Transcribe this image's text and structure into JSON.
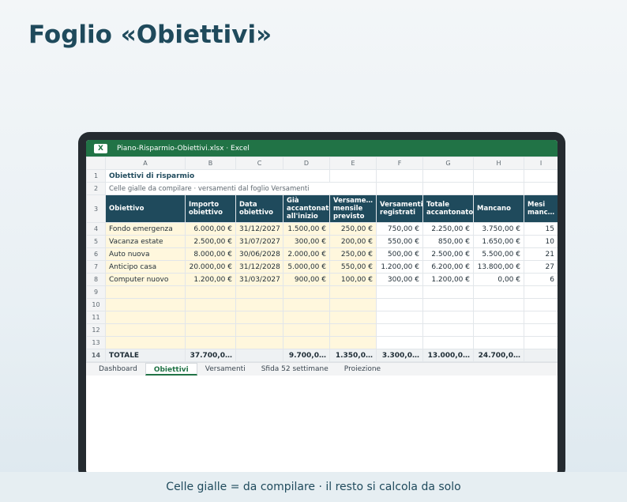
{
  "page": {
    "title": "Foglio «Obiettivi»",
    "footer": "Celle gialle = da compilare · il resto si calcola da solo"
  },
  "window": {
    "app_icon": "X",
    "title": "Piano-Risparmio-Obiettivi.xlsx · Excel"
  },
  "columns": [
    "A",
    "B",
    "C",
    "D",
    "E",
    "F",
    "G",
    "H",
    "I"
  ],
  "sheet": {
    "title": "Obiettivi di risparmio",
    "subtitle": "Celle gialle da compilare · versamenti dal foglio Versamenti",
    "headers": [
      "Obiettivo",
      "Importo obiettivo",
      "Data obiettivo",
      "Già accantonato all'inizio",
      "Versamento mensile previsto",
      "Versamenti registrati",
      "Totale accantonato",
      "Mancano",
      "Mesi mancanti"
    ],
    "headers_display": [
      "Obiettivo",
      "Importo obiettivo",
      "Data obiettivo",
      "Già accantonato all'inizio",
      "Versame… mensile previsto",
      "Versamenti registrati",
      "Totale accantonato",
      "Mancano",
      "Mesi manc…"
    ],
    "rows": [
      [
        "Fondo emergenza",
        "6.000,00 €",
        "31/12/2027",
        "1.500,00 €",
        "250,00 €",
        "750,00 €",
        "2.250,00 €",
        "3.750,00 €",
        "15"
      ],
      [
        "Vacanza estate",
        "2.500,00 €",
        "31/07/2027",
        "300,00 €",
        "200,00 €",
        "550,00 €",
        "850,00 €",
        "1.650,00 €",
        "10"
      ],
      [
        "Auto nuova",
        "8.000,00 €",
        "30/06/2028",
        "2.000,00 €",
        "250,00 €",
        "500,00 €",
        "2.500,00 €",
        "5.500,00 €",
        "21"
      ],
      [
        "Anticipo casa",
        "20.000,00 €",
        "31/12/2028",
        "5.000,00 €",
        "550,00 €",
        "1.200,00 €",
        "6.200,00 €",
        "13.800,00 €",
        "27"
      ],
      [
        "Computer nuovo",
        "1.200,00 €",
        "31/03/2027",
        "900,00 €",
        "100,00 €",
        "300,00 €",
        "1.200,00 €",
        "0,00 €",
        "6"
      ]
    ],
    "row_numbers": [
      "1",
      "2",
      "3",
      "4",
      "5",
      "6",
      "7",
      "8",
      "9",
      "10",
      "11",
      "12",
      "13",
      "14"
    ],
    "total": [
      "TOTALE",
      "37.700,0…",
      "",
      "9.700,0…",
      "1.350,0…",
      "3.300,0…",
      "13.000,0…",
      "24.700,0…",
      ""
    ]
  },
  "tabs": [
    {
      "label": "Dashboard",
      "active": false
    },
    {
      "label": "Obiettivi",
      "active": true
    },
    {
      "label": "Versamenti",
      "active": false
    },
    {
      "label": "Sfida 52 settimane",
      "active": false
    },
    {
      "label": "Proiezione",
      "active": false
    }
  ],
  "colors": {
    "brand": "#217346",
    "header": "#1f4a5c",
    "input_cell": "#fff7dd"
  }
}
